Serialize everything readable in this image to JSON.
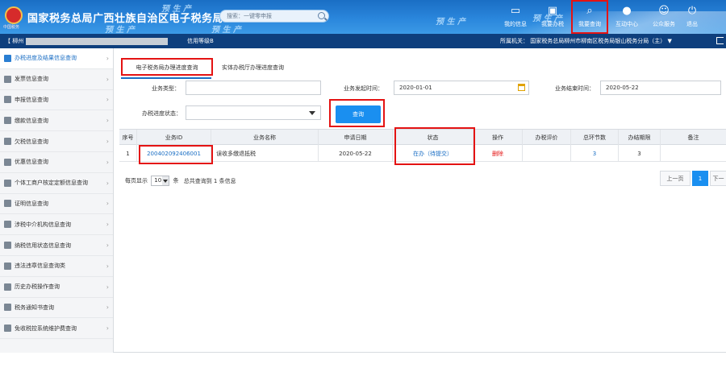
{
  "header": {
    "site_title": "国家税务总局广西壮族自治区电子税务局",
    "logo_text": "中国税务",
    "watermark": "预 生 产",
    "search_placeholder": "搜索：一键零申报",
    "nav": [
      {
        "label": "我的信息",
        "icon": "user-card-icon"
      },
      {
        "label": "我要办税",
        "icon": "tax-handling-icon"
      },
      {
        "label": "我要查询",
        "icon": "query-icon"
      },
      {
        "label": "互动中心",
        "icon": "chat-icon"
      },
      {
        "label": "公众服务",
        "icon": "public-service-icon"
      },
      {
        "label": "退出",
        "icon": "exit-icon"
      }
    ]
  },
  "subbar": {
    "prefix": "【 柳州",
    "credit": "信用等级B",
    "authority_label": "所属机关：",
    "authority": "国家税务总局柳州市柳南区税务局银山税务分局（主）"
  },
  "sidebar": {
    "items": [
      {
        "label": "办税进度及结果信息查询",
        "active": true
      },
      {
        "label": "发票信息查询"
      },
      {
        "label": "申报信息查询"
      },
      {
        "label": "缴款信息查询"
      },
      {
        "label": "欠税信息查询"
      },
      {
        "label": "优惠信息查询"
      },
      {
        "label": "个体工商户核定定额信息查询"
      },
      {
        "label": "证明信息查询"
      },
      {
        "label": "涉税中介机构信息查询"
      },
      {
        "label": "纳税信用状态信息查询"
      },
      {
        "label": "违法违章信息查询类"
      },
      {
        "label": "历史办税操作查询"
      },
      {
        "label": "税务通知书查询"
      },
      {
        "label": "免收税控系统维护费查询"
      }
    ]
  },
  "tabs": [
    "电子税务局办理进度查询",
    "实体办税厅办理进度查询"
  ],
  "form": {
    "business_type_label": "业务类型：",
    "business_type_value": "",
    "start_time_label": "业务发起时间：",
    "start_time_value": "2020-01-01",
    "end_time_label": "业务结束时间：",
    "end_time_value": "2020-05-22",
    "progress_status_label": "办税进度状态：",
    "progress_status_value": "",
    "query_button": "查询"
  },
  "table": {
    "columns": [
      "序号",
      "业务ID",
      "业务名称",
      "申请日期",
      "状态",
      "操作",
      "办税评价",
      "总环节数",
      "办结期限",
      "备注"
    ],
    "rows": [
      {
        "index": "1",
        "business_id": "200402092406001",
        "business_name": "误收多缴退抵税",
        "apply_date": "2020-05-22",
        "status": "在办（待提交）",
        "action": "删除",
        "evaluation": "",
        "total_steps": "3",
        "deadline": "3",
        "remark": ""
      }
    ]
  },
  "pager": {
    "per_page_label": "每页显示",
    "per_page_value": "10",
    "unit": "条",
    "summary": "总共查询到 1 条信息",
    "prev": "上一页",
    "current": "1",
    "next": "下一"
  },
  "colors": {
    "header_blue": "#2a86dc",
    "subbar_navy": "#0e3f7d",
    "accent_blue": "#1a8ff0",
    "annotation_red": "#e41313"
  }
}
